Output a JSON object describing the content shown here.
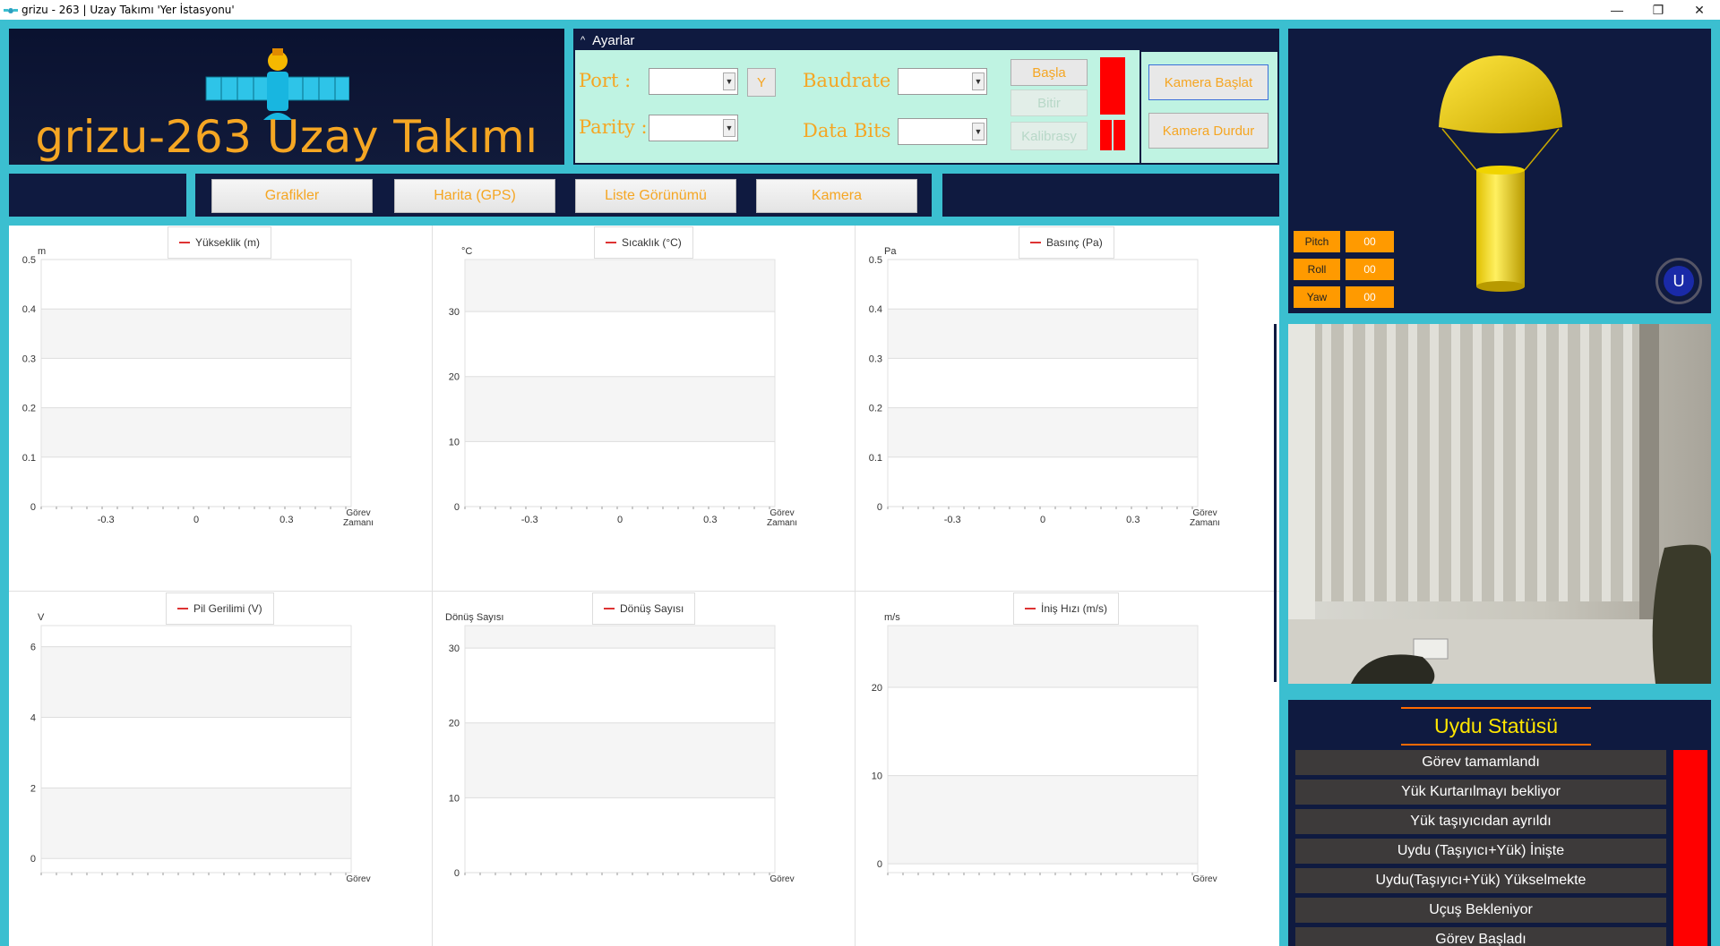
{
  "window": {
    "title": "grizu - 263 | Uzay Takımı  'Yer İstasyonu'",
    "controls": [
      "—",
      "❐",
      "✕"
    ]
  },
  "logo": {
    "text": "grizu-263 Uzay Takımı"
  },
  "settings": {
    "header": "Ayarlar",
    "port_label": "Port   :",
    "parity_label": "Parity :",
    "baudrate_label": "Baudrate :",
    "databits_label": "Data Bits :",
    "refresh_label": "Y",
    "start_label": "Başla",
    "stop_label": "Bitir",
    "calibrate_label": "Kalibrasy",
    "port_value": "",
    "parity_value": "",
    "baudrate_value": "",
    "databits_value": ""
  },
  "camera_controls": {
    "start_label": "Kamera Başlat",
    "stop_label": "Kamera Durdur"
  },
  "nav": {
    "tabs": [
      "Grafikler",
      "Harita (GPS)",
      "Liste Görünümü",
      "Kamera"
    ]
  },
  "colors": {
    "accent": "#f5a623",
    "dark_panel": "#0f1a40",
    "frame": "#3bbfd0",
    "indicator_red": "#ff0000",
    "series_red": "#d33333"
  },
  "chart_data": [
    {
      "type": "line",
      "legend": "Yükseklik (m)",
      "ylabel": "m",
      "xlabel": "Görev Zamanı",
      "ylim": [
        0,
        0.5
      ],
      "y_ticks": [
        "0",
        "0.1",
        "0.2",
        "0.3",
        "0.4",
        "0.5"
      ],
      "x_ticks": [
        "-0.3",
        "0",
        "0.3"
      ],
      "series": [
        {
          "name": "Yükseklik (m)",
          "values": []
        }
      ]
    },
    {
      "type": "line",
      "legend": "Sıcaklık (°C)",
      "ylabel": "°C",
      "xlabel": "Görev Zamanı",
      "ylim": [
        0,
        38
      ],
      "y_ticks": [
        "0",
        "10",
        "20",
        "30"
      ],
      "x_ticks": [
        "-0.3",
        "0",
        "0.3"
      ],
      "series": [
        {
          "name": "Sıcaklık (°C)",
          "values": []
        }
      ]
    },
    {
      "type": "line",
      "legend": "Basınç (Pa)",
      "ylabel": "Pa",
      "xlabel": "Görev Zamanı",
      "ylim": [
        0,
        0.5
      ],
      "y_ticks": [
        "0",
        "0.1",
        "0.2",
        "0.3",
        "0.4",
        "0.5"
      ],
      "x_ticks": [
        "-0.3",
        "0",
        "0.3"
      ],
      "series": [
        {
          "name": "Basınç (Pa)",
          "values": []
        }
      ]
    },
    {
      "type": "line",
      "legend": "Pil Gerilimi (V)",
      "ylabel": "V",
      "xlabel": "Görev",
      "ylim": [
        -0.4,
        6.6
      ],
      "y_ticks": [
        "0",
        "2",
        "4",
        "6"
      ],
      "x_ticks": [],
      "series": [
        {
          "name": "Pil Gerilimi (V)",
          "values": []
        }
      ]
    },
    {
      "type": "line",
      "legend": "Dönüş Sayısı",
      "ylabel": "Dönüş Sayısı",
      "xlabel": "Görev",
      "ylim": [
        0,
        33
      ],
      "y_ticks": [
        "0",
        "10",
        "20",
        "30"
      ],
      "x_ticks": [],
      "series": [
        {
          "name": "Dönüş Sayısı",
          "values": []
        }
      ]
    },
    {
      "type": "line",
      "legend": "İniş Hızı (m/s)",
      "ylabel": "m/s",
      "xlabel": "Görev",
      "ylim": [
        -1,
        27
      ],
      "y_ticks": [
        "0",
        "10",
        "20"
      ],
      "x_ticks": [],
      "series": [
        {
          "name": "İniş Hızı (m/s)",
          "values": []
        }
      ]
    }
  ],
  "attitude": {
    "pitch_label": "Pitch",
    "pitch_value": "00",
    "roll_label": "Roll",
    "roll_value": "00",
    "yaw_label": "Yaw",
    "yaw_value": "00",
    "badge": "U"
  },
  "status": {
    "title": "Uydu Statüsü",
    "items": [
      "Görev tamamlandı",
      "Yük Kurtarılmayı bekliyor",
      "Yük taşıyıcıdan ayrıldı",
      "Uydu (Taşıyıcı+Yük) İnişte",
      "Uydu(Taşıyıcı+Yük) Yükselmekte",
      "Uçuş Bekleniyor",
      "Görev Başladı"
    ]
  }
}
